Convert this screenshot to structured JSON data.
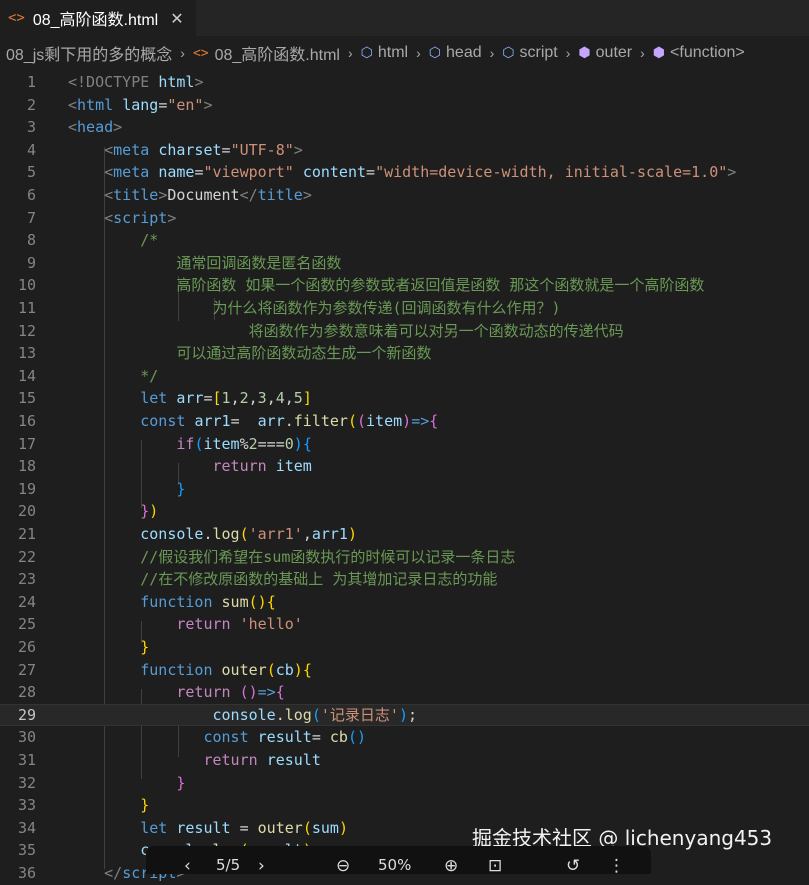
{
  "tab": {
    "icon": "html-file-icon",
    "title": "08_高阶函数.html",
    "close": "✕"
  },
  "breadcrumb": [
    "08_js剩下用的多的概念",
    "08_高阶函数.html",
    "html",
    "head",
    "script",
    "outer",
    "<function>"
  ],
  "watermark": "掘金技术社区 @ lichenyang453",
  "overlay": {
    "page": "5/5",
    "zoom": "50%"
  },
  "code_lines": [
    {
      "n": "1",
      "tokens": [
        {
          "t": "<!DOCTYPE ",
          "c": "br"
        },
        {
          "t": "html",
          "c": "attr"
        },
        {
          "t": ">",
          "c": "br"
        }
      ]
    },
    {
      "n": "2",
      "tokens": [
        {
          "t": "<",
          "c": "br"
        },
        {
          "t": "html",
          "c": "tag"
        },
        {
          "t": " ",
          "c": "txt"
        },
        {
          "t": "lang",
          "c": "attr"
        },
        {
          "t": "=",
          "c": "txt"
        },
        {
          "t": "\"en\"",
          "c": "str"
        },
        {
          "t": ">",
          "c": "br"
        }
      ]
    },
    {
      "n": "3",
      "tokens": [
        {
          "t": "<",
          "c": "br"
        },
        {
          "t": "head",
          "c": "tag"
        },
        {
          "t": ">",
          "c": "br"
        }
      ]
    },
    {
      "n": "4",
      "tokens": [
        {
          "t": "    <",
          "c": "br"
        },
        {
          "t": "meta",
          "c": "tag"
        },
        {
          "t": " ",
          "c": "txt"
        },
        {
          "t": "charset",
          "c": "attr"
        },
        {
          "t": "=",
          "c": "txt"
        },
        {
          "t": "\"UTF-8\"",
          "c": "str"
        },
        {
          "t": ">",
          "c": "br"
        }
      ]
    },
    {
      "n": "5",
      "tokens": [
        {
          "t": "    <",
          "c": "br"
        },
        {
          "t": "meta",
          "c": "tag"
        },
        {
          "t": " ",
          "c": "txt"
        },
        {
          "t": "name",
          "c": "attr"
        },
        {
          "t": "=",
          "c": "txt"
        },
        {
          "t": "\"viewport\"",
          "c": "str"
        },
        {
          "t": " ",
          "c": "txt"
        },
        {
          "t": "content",
          "c": "attr"
        },
        {
          "t": "=",
          "c": "txt"
        },
        {
          "t": "\"width=device-width, initial-scale=1.0\"",
          "c": "str"
        },
        {
          "t": ">",
          "c": "br"
        }
      ]
    },
    {
      "n": "6",
      "tokens": [
        {
          "t": "    <",
          "c": "br"
        },
        {
          "t": "title",
          "c": "tag"
        },
        {
          "t": ">",
          "c": "br"
        },
        {
          "t": "Document",
          "c": "txt"
        },
        {
          "t": "</",
          "c": "br"
        },
        {
          "t": "title",
          "c": "tag"
        },
        {
          "t": ">",
          "c": "br"
        }
      ]
    },
    {
      "n": "7",
      "tokens": [
        {
          "t": "    <",
          "c": "br"
        },
        {
          "t": "script",
          "c": "tag"
        },
        {
          "t": ">",
          "c": "br"
        }
      ]
    },
    {
      "n": "8",
      "tokens": [
        {
          "t": "        /*",
          "c": "cm"
        }
      ]
    },
    {
      "n": "9",
      "tokens": [
        {
          "t": "            通常回调函数是匿名函数",
          "c": "cm"
        }
      ]
    },
    {
      "n": "10",
      "tokens": [
        {
          "t": "            高阶函数 如果一个函数的参数或者返回值是函数 那这个函数就是一个高阶函数",
          "c": "cm"
        }
      ]
    },
    {
      "n": "11",
      "tokens": [
        {
          "t": "                为什么将函数作为参数传递(回调函数有什么作用？)",
          "c": "cm"
        }
      ]
    },
    {
      "n": "12",
      "tokens": [
        {
          "t": "                    将函数作为参数意味着可以对另一个函数动态的传递代码",
          "c": "cm"
        }
      ]
    },
    {
      "n": "13",
      "tokens": [
        {
          "t": "            可以通过高阶函数动态生成一个新函数",
          "c": "cm"
        }
      ]
    },
    {
      "n": "14",
      "tokens": [
        {
          "t": "        */",
          "c": "cm"
        }
      ]
    },
    {
      "n": "15",
      "tokens": [
        {
          "t": "        ",
          "c": "txt"
        },
        {
          "t": "let",
          "c": "kw"
        },
        {
          "t": " ",
          "c": "txt"
        },
        {
          "t": "arr",
          "c": "var"
        },
        {
          "t": "=",
          "c": "txt"
        },
        {
          "t": "[",
          "c": "p1"
        },
        {
          "t": "1",
          "c": "num"
        },
        {
          "t": ",",
          "c": "txt"
        },
        {
          "t": "2",
          "c": "num"
        },
        {
          "t": ",",
          "c": "txt"
        },
        {
          "t": "3",
          "c": "num"
        },
        {
          "t": ",",
          "c": "txt"
        },
        {
          "t": "4",
          "c": "num"
        },
        {
          "t": ",",
          "c": "txt"
        },
        {
          "t": "5",
          "c": "num"
        },
        {
          "t": "]",
          "c": "p1"
        }
      ]
    },
    {
      "n": "16",
      "tokens": [
        {
          "t": "        ",
          "c": "txt"
        },
        {
          "t": "const",
          "c": "kw"
        },
        {
          "t": " ",
          "c": "txt"
        },
        {
          "t": "arr1",
          "c": "var"
        },
        {
          "t": "=  ",
          "c": "txt"
        },
        {
          "t": "arr",
          "c": "var"
        },
        {
          "t": ".",
          "c": "txt"
        },
        {
          "t": "filter",
          "c": "fn"
        },
        {
          "t": "(",
          "c": "p1"
        },
        {
          "t": "(",
          "c": "p2"
        },
        {
          "t": "item",
          "c": "var"
        },
        {
          "t": ")",
          "c": "p2"
        },
        {
          "t": "=>",
          "c": "kw"
        },
        {
          "t": "{",
          "c": "p2"
        }
      ]
    },
    {
      "n": "17",
      "tokens": [
        {
          "t": "            ",
          "c": "txt"
        },
        {
          "t": "if",
          "c": "ctl"
        },
        {
          "t": "(",
          "c": "p3"
        },
        {
          "t": "item",
          "c": "var"
        },
        {
          "t": "%",
          "c": "txt"
        },
        {
          "t": "2",
          "c": "num"
        },
        {
          "t": "===",
          "c": "txt"
        },
        {
          "t": "0",
          "c": "num"
        },
        {
          "t": ")",
          "c": "p3"
        },
        {
          "t": "{",
          "c": "p3"
        }
      ]
    },
    {
      "n": "18",
      "tokens": [
        {
          "t": "                ",
          "c": "txt"
        },
        {
          "t": "return",
          "c": "ctl"
        },
        {
          "t": " ",
          "c": "txt"
        },
        {
          "t": "item",
          "c": "var"
        }
      ]
    },
    {
      "n": "19",
      "tokens": [
        {
          "t": "            ",
          "c": "txt"
        },
        {
          "t": "}",
          "c": "p3"
        }
      ]
    },
    {
      "n": "20",
      "tokens": [
        {
          "t": "        ",
          "c": "txt"
        },
        {
          "t": "}",
          "c": "p2"
        },
        {
          "t": ")",
          "c": "p1"
        }
      ]
    },
    {
      "n": "21",
      "tokens": [
        {
          "t": "        ",
          "c": "txt"
        },
        {
          "t": "console",
          "c": "var"
        },
        {
          "t": ".",
          "c": "txt"
        },
        {
          "t": "log",
          "c": "fn"
        },
        {
          "t": "(",
          "c": "p1"
        },
        {
          "t": "'arr1'",
          "c": "str"
        },
        {
          "t": ",",
          "c": "txt"
        },
        {
          "t": "arr1",
          "c": "var"
        },
        {
          "t": ")",
          "c": "p1"
        }
      ]
    },
    {
      "n": "22",
      "tokens": [
        {
          "t": "        //假设我们希望在sum函数执行的时候可以记录一条日志",
          "c": "cm"
        }
      ]
    },
    {
      "n": "23",
      "tokens": [
        {
          "t": "        //在不修改原函数的基础上 为其增加记录日志的功能",
          "c": "cm"
        }
      ]
    },
    {
      "n": "24",
      "tokens": [
        {
          "t": "        ",
          "c": "txt"
        },
        {
          "t": "function",
          "c": "kw"
        },
        {
          "t": " ",
          "c": "txt"
        },
        {
          "t": "sum",
          "c": "fn"
        },
        {
          "t": "(",
          "c": "p1"
        },
        {
          "t": ")",
          "c": "p1"
        },
        {
          "t": "{",
          "c": "p1"
        }
      ]
    },
    {
      "n": "25",
      "tokens": [
        {
          "t": "            ",
          "c": "txt"
        },
        {
          "t": "return",
          "c": "ctl"
        },
        {
          "t": " ",
          "c": "txt"
        },
        {
          "t": "'hello'",
          "c": "str"
        }
      ]
    },
    {
      "n": "26",
      "tokens": [
        {
          "t": "        ",
          "c": "txt"
        },
        {
          "t": "}",
          "c": "p1"
        }
      ]
    },
    {
      "n": "27",
      "tokens": [
        {
          "t": "        ",
          "c": "txt"
        },
        {
          "t": "function",
          "c": "kw"
        },
        {
          "t": " ",
          "c": "txt"
        },
        {
          "t": "outer",
          "c": "fn"
        },
        {
          "t": "(",
          "c": "p1"
        },
        {
          "t": "cb",
          "c": "var"
        },
        {
          "t": ")",
          "c": "p1"
        },
        {
          "t": "{",
          "c": "p1"
        }
      ]
    },
    {
      "n": "28",
      "tokens": [
        {
          "t": "            ",
          "c": "txt"
        },
        {
          "t": "return",
          "c": "ctl"
        },
        {
          "t": " ",
          "c": "txt"
        },
        {
          "t": "(",
          "c": "p2"
        },
        {
          "t": ")",
          "c": "p2"
        },
        {
          "t": "=>",
          "c": "kw"
        },
        {
          "t": "{",
          "c": "p2"
        }
      ]
    },
    {
      "n": "29",
      "tokens": [
        {
          "t": "                ",
          "c": "txt"
        },
        {
          "t": "console",
          "c": "var"
        },
        {
          "t": ".",
          "c": "txt"
        },
        {
          "t": "log",
          "c": "fn"
        },
        {
          "t": "(",
          "c": "p3"
        },
        {
          "t": "'记录日志'",
          "c": "str"
        },
        {
          "t": ")",
          "c": "p3"
        },
        {
          "t": ";",
          "c": "txt"
        }
      ]
    },
    {
      "n": "30",
      "tokens": [
        {
          "t": "               ",
          "c": "txt"
        },
        {
          "t": "const",
          "c": "kw"
        },
        {
          "t": " ",
          "c": "txt"
        },
        {
          "t": "result",
          "c": "var"
        },
        {
          "t": "= ",
          "c": "txt"
        },
        {
          "t": "cb",
          "c": "fn"
        },
        {
          "t": "(",
          "c": "p3"
        },
        {
          "t": ")",
          "c": "p3"
        }
      ]
    },
    {
      "n": "31",
      "tokens": [
        {
          "t": "               ",
          "c": "txt"
        },
        {
          "t": "return",
          "c": "ctl"
        },
        {
          "t": " ",
          "c": "txt"
        },
        {
          "t": "result",
          "c": "var"
        }
      ]
    },
    {
      "n": "32",
      "tokens": [
        {
          "t": "            ",
          "c": "txt"
        },
        {
          "t": "}",
          "c": "p2"
        }
      ]
    },
    {
      "n": "33",
      "tokens": [
        {
          "t": "        ",
          "c": "txt"
        },
        {
          "t": "}",
          "c": "p1"
        }
      ]
    },
    {
      "n": "34",
      "tokens": [
        {
          "t": "        ",
          "c": "txt"
        },
        {
          "t": "let",
          "c": "kw"
        },
        {
          "t": " ",
          "c": "txt"
        },
        {
          "t": "result",
          "c": "var"
        },
        {
          "t": " = ",
          "c": "txt"
        },
        {
          "t": "outer",
          "c": "fn"
        },
        {
          "t": "(",
          "c": "p1"
        },
        {
          "t": "sum",
          "c": "var"
        },
        {
          "t": ")",
          "c": "p1"
        }
      ]
    },
    {
      "n": "35",
      "tokens": [
        {
          "t": "        ",
          "c": "txt"
        },
        {
          "t": "console",
          "c": "var"
        },
        {
          "t": ".",
          "c": "txt"
        },
        {
          "t": "log",
          "c": "fn"
        },
        {
          "t": "(",
          "c": "p1"
        },
        {
          "t": "result",
          "c": "var"
        },
        {
          "t": ")",
          "c": "p1"
        },
        {
          "t": ";",
          "c": "txt"
        }
      ]
    },
    {
      "n": "36",
      "tokens": [
        {
          "t": "    </",
          "c": "br"
        },
        {
          "t": "script",
          "c": "tag"
        },
        {
          "t": ">",
          "c": "br"
        }
      ]
    }
  ],
  "current_line": "29"
}
